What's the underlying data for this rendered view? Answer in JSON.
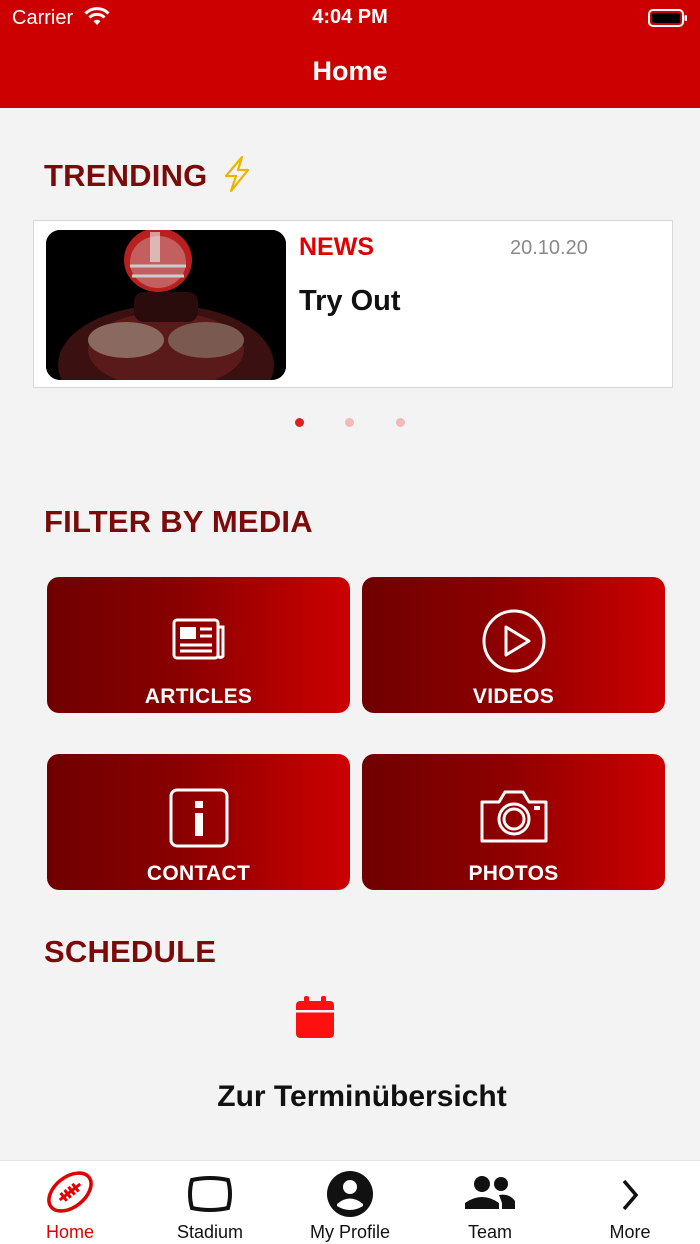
{
  "status_bar": {
    "carrier": "Carrier",
    "time": "4:04 PM"
  },
  "nav": {
    "title": "Home"
  },
  "trending": {
    "title": "TRENDING",
    "card": {
      "category": "NEWS",
      "date": "20.10.20",
      "headline": "Try Out"
    },
    "page_dots": {
      "count": 3,
      "active": 0
    }
  },
  "filter": {
    "title": "FILTER BY MEDIA",
    "tiles": [
      {
        "label": "ARTICLES",
        "icon": "newspaper-icon"
      },
      {
        "label": "VIDEOS",
        "icon": "play-circle-icon"
      },
      {
        "label": "CONTACT",
        "icon": "info-icon"
      },
      {
        "label": "PHOTOS",
        "icon": "camera-icon"
      }
    ]
  },
  "schedule": {
    "title": "SCHEDULE",
    "link": "Zur Terminübersicht"
  },
  "tabbar": {
    "tabs": [
      {
        "label": "Home",
        "icon": "football-icon",
        "active": true
      },
      {
        "label": "Stadium",
        "icon": "screen-icon",
        "active": false
      },
      {
        "label": "My Profile",
        "icon": "profile-icon",
        "active": false
      },
      {
        "label": "Team",
        "icon": "team-icon",
        "active": false
      },
      {
        "label": "More",
        "icon": "chevron-right-icon",
        "active": false
      }
    ]
  },
  "colors": {
    "brand_red": "#cc0000",
    "title_dark_red": "#7b0a0a",
    "accent": "#e00000"
  }
}
